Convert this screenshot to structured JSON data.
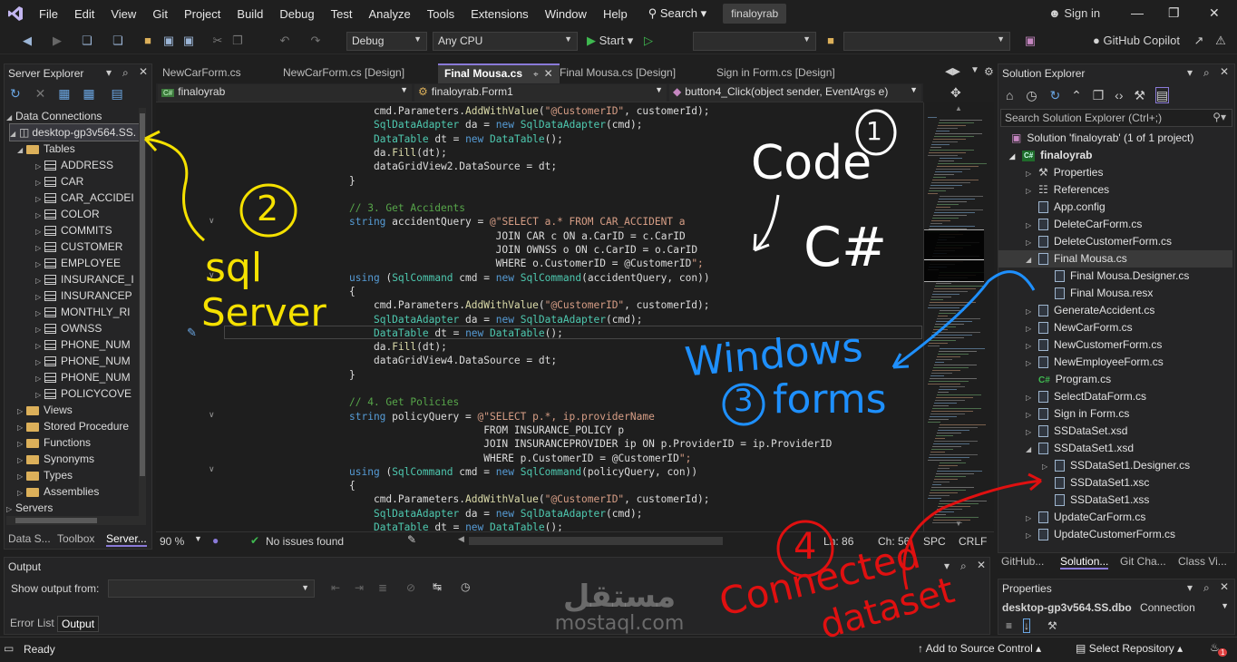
{
  "menu": {
    "items": [
      "File",
      "Edit",
      "View",
      "Git",
      "Project",
      "Build",
      "Debug",
      "Test",
      "Analyze",
      "Tools",
      "Extensions",
      "Window",
      "Help"
    ],
    "search_label": "Search",
    "solution_name": "finaloyrab",
    "sign_in": "Sign in"
  },
  "toolbar": {
    "config": "Debug",
    "platform": "Any CPU",
    "start_label": "Start",
    "copilot": "GitHub Copilot"
  },
  "server_explorer": {
    "title": "Server Explorer",
    "root": "Data Connections",
    "connection": "desktop-gp3v564.SS.",
    "tables_label": "Tables",
    "tables": [
      "ADDRESS",
      "CAR",
      "CAR_ACCIDEI",
      "COLOR",
      "COMMITS",
      "CUSTOMER",
      "EMPLOYEE",
      "INSURANCE_I",
      "INSURANCEP",
      "MONTHLY_RI",
      "OWNSS",
      "PHONE_NUM",
      "PHONE_NUM",
      "PHONE_NUM",
      "POLICYCOVE"
    ],
    "folders": [
      "Views",
      "Stored Procedure",
      "Functions",
      "Synonyms",
      "Types",
      "Assemblies"
    ],
    "servers": "Servers",
    "bottom_tabs": [
      "Data S...",
      "Toolbox",
      "Server..."
    ]
  },
  "editor": {
    "tabs": [
      "NewCarForm.cs",
      "NewCarForm.cs [Design]",
      "Final Mousa.cs",
      "Final Mousa.cs [Design]",
      "Sign in Form.cs [Design]"
    ],
    "nav": {
      "project": "finaloyrab",
      "class": "finaloyrab.Form1",
      "member": "button4_Click(object sender, EventArgs e)"
    },
    "status": {
      "zoom": "90 %",
      "issues": "No issues found",
      "line": "Ln: 86",
      "col": "Ch: 56",
      "spc": "SPC",
      "crlf": "CRLF"
    }
  },
  "code_lines": [
    "cmd.Parameters.AddWithValue(\"@CustomerID\", customerId);",
    "SqlDataAdapter da = new SqlDataAdapter(cmd);",
    "DataTable dt = new DataTable();",
    "da.Fill(dt);",
    "dataGridView2.DataSource = dt;",
    "}",
    "",
    "// 3. Get Accidents",
    "string accidentQuery = @\"SELECT a.* FROM CAR_ACCIDENT a",
    "                        JOIN CAR c ON a.CarID = c.CarID",
    "                        JOIN OWNSS o ON c.CarID = o.CarID",
    "                        WHERE o.CustomerID = @CustomerID\";",
    "using (SqlCommand cmd = new SqlCommand(accidentQuery, con))",
    "{",
    "    cmd.Parameters.AddWithValue(\"@CustomerID\", customerId);",
    "    SqlDataAdapter da = new SqlDataAdapter(cmd);",
    "    DataTable dt = new DataTable();",
    "    da.Fill(dt);",
    "    dataGridView4.DataSource = dt;",
    "}",
    "",
    "// 4. Get Policies",
    "string policyQuery = @\"SELECT p.*, ip.providerName",
    "                      FROM INSURANCE_POLICY p",
    "                      JOIN INSURANCEPROVIDER ip ON p.ProviderID = ip.ProviderID",
    "                      WHERE p.CustomerID = @CustomerID\";",
    "using (SqlCommand cmd = new SqlCommand(policyQuery, con))",
    "{",
    "    cmd.Parameters.AddWithValue(\"@CustomerID\", customerId);",
    "    SqlDataAdapter da = new SqlDataAdapter(cmd);",
    "    DataTable dt = new DataTable();"
  ],
  "solution_explorer": {
    "title": "Solution Explorer",
    "search_placeholder": "Search Solution Explorer (Ctrl+;)",
    "solution": "Solution 'finaloyrab' (1 of 1 project)",
    "project": "finaloyrab",
    "items": [
      "Properties",
      "References",
      "App.config",
      "DeleteCarForm.cs",
      "DeleteCustomerForm.cs",
      "Final Mousa.cs",
      "Final Mousa.Designer.cs",
      "Final Mousa.resx",
      "GenerateAccident.cs",
      "NewCarForm.cs",
      "NewCustomerForm.cs",
      "NewEmployeeForm.cs",
      "Program.cs",
      "SelectDataForm.cs",
      "Sign in Form.cs",
      "SSDataSet.xsd",
      "SSDataSet1.xsd",
      "SSDataSet1.Designer.cs",
      "SSDataSet1.xsc",
      "SSDataSet1.xss",
      "UpdateCarForm.cs",
      "UpdateCustomerForm.cs"
    ],
    "bottom_tabs": [
      "GitHub...",
      "Solution...",
      "Git Cha...",
      "Class Vi..."
    ]
  },
  "output": {
    "title": "Output",
    "show_from": "Show output from:",
    "tabs": [
      "Error List",
      "Output"
    ]
  },
  "properties": {
    "title": "Properties",
    "object": "desktop-gp3v564.SS.dbo",
    "type": "Connection"
  },
  "statusbar": {
    "ready": "Ready",
    "source_control": "Add to Source Control",
    "repository": "Select Repository",
    "notifications": "1"
  },
  "annotations": {
    "n1": "1",
    "code": "Code",
    "csharp": "C#",
    "n2": "2",
    "sql": "sql",
    "server": "Server",
    "windows": "Windows",
    "n3": "3",
    "forms": "forms",
    "n4": "4",
    "connected": "Connected",
    "dataset": "dataset"
  },
  "watermark": {
    "arabic": "مستقل",
    "latin": "mostaql.com"
  },
  "colors": {
    "accent": "#8a7ad8",
    "keyword": "#569cd6",
    "type": "#4ec9b0",
    "string": "#d69d85",
    "comment": "#57a64a",
    "yellow_ink": "#f5e100",
    "blue_ink": "#1e90ff",
    "red_ink": "#e01010"
  }
}
